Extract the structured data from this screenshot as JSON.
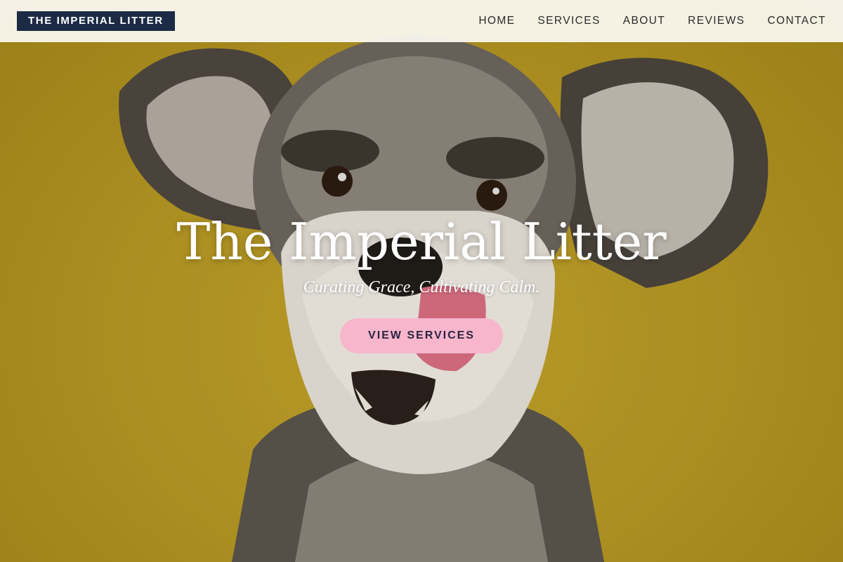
{
  "brand": {
    "name": "THE IMPERIAL LITTER"
  },
  "nav": {
    "items": [
      {
        "label": "HOME"
      },
      {
        "label": "SERVICES"
      },
      {
        "label": "ABOUT"
      },
      {
        "label": "REVIEWS"
      },
      {
        "label": "CONTACT"
      }
    ]
  },
  "hero": {
    "title": "The Imperial Litter",
    "subtitle": "Curating Grace, Cultivating Calm.",
    "cta_label": "VIEW SERVICES",
    "background_photo": "schnauzer-dog-on-mustard-yellow-backdrop"
  },
  "colors": {
    "brand_bg": "#1c2a45",
    "cta_bg": "#f7b6cc",
    "hero_bg": "#b99a26",
    "header_bg": "#faf8f0"
  }
}
